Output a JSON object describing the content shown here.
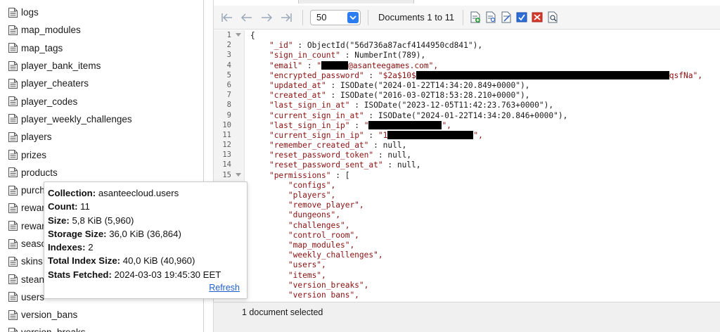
{
  "sidebar": {
    "items": [
      {
        "label": "logs"
      },
      {
        "label": "map_modules"
      },
      {
        "label": "map_tags"
      },
      {
        "label": "player_bank_items"
      },
      {
        "label": "player_cheaters"
      },
      {
        "label": "player_codes"
      },
      {
        "label": "player_weekly_challenges"
      },
      {
        "label": "players"
      },
      {
        "label": "prizes"
      },
      {
        "label": "products"
      },
      {
        "label": "purch"
      },
      {
        "label": "rewar"
      },
      {
        "label": "rewar"
      },
      {
        "label": "seaso"
      },
      {
        "label": "skins"
      },
      {
        "label": "stean"
      },
      {
        "label": "users"
      },
      {
        "label": "version_bans"
      },
      {
        "label": "version_breaks"
      }
    ],
    "icon": "collection-document-icon"
  },
  "toolbar": {
    "page_size": "50",
    "documents_range": "Documents 1 to 11",
    "nav_icons": [
      "first-page-icon",
      "previous-page-icon",
      "next-page-icon",
      "last-page-icon"
    ],
    "tool_icons": [
      "add-document-icon",
      "view-document-icon",
      "edit-document-icon",
      "select-document-icon",
      "delete-document-icon",
      "find-document-icon"
    ]
  },
  "editor": {
    "line_numbers": [
      "1",
      "2",
      "3",
      "4",
      "5",
      "6",
      "7",
      "8",
      "9",
      "10",
      "11",
      "12",
      "13",
      "14",
      "15",
      "",
      "",
      "",
      "",
      "",
      "",
      "",
      "",
      "",
      "",
      "",
      ""
    ],
    "colors": {
      "key": "#8a1010",
      "string": "#8a1010",
      "gutter": "#f3f3f3"
    }
  },
  "document": {
    "open": "{",
    "id_key": "\"_id\"",
    "id_val": "ObjectId(\"56d736a87acf4144950cd841\"),",
    "sign_in_count_key": "\"sign_in_count\"",
    "sign_in_count_val": "NumberInt(789),",
    "email_key": "\"email\"",
    "email_pre": "\"",
    "email_post": "@asanteegames.com\",",
    "encrypted_password_key": "\"encrypted_password\"",
    "encrypted_password_pre": "\"$2a$10$",
    "encrypted_password_post": "qsfNa\",",
    "updated_at_key": "\"updated_at\"",
    "updated_at_val": "ISODate(\"2024-01-22T14:34:20.849+0000\"),",
    "created_at_key": "\"created_at\"",
    "created_at_val": "ISODate(\"2016-03-02T18:53:28.210+0000\"),",
    "last_sign_in_at_key": "\"last_sign_in_at\"",
    "last_sign_in_at_val": "ISODate(\"2023-12-05T11:42:23.763+0000\"),",
    "current_sign_in_at_key": "\"current_sign_in_at\"",
    "current_sign_in_at_val": "ISODate(\"2024-01-22T14:34:20.846+0000\"),",
    "last_sign_in_ip_key": "\"last_sign_in_ip\"",
    "last_sign_in_ip_pre": "\"",
    "last_sign_in_ip_post": "\",",
    "current_sign_in_ip_key": "\"current_sign_in_ip\"",
    "current_sign_in_ip_pre": "\"1",
    "current_sign_in_ip_post": "\",",
    "remember_created_at_key": "\"remember_created_at\"",
    "remember_created_at_val": "null,",
    "reset_password_token_key": "\"reset_password_token\"",
    "reset_password_token_val": "null,",
    "reset_password_sent_at_key": "\"reset_password_sent_at\"",
    "reset_password_sent_at_val": "null,",
    "permissions_key": "\"permissions\"",
    "permissions_open": "[",
    "permissions": [
      "\"configs\",",
      "\"players\",",
      "\"remove_player\",",
      "\"dungeons\",",
      "\"challenges\",",
      "\"control_room\",",
      "\"map_modules\",",
      "\"weekly_challenges\",",
      "\"users\",",
      "\"items\",",
      "\"version_breaks\",",
      "\"version_bans\","
    ]
  },
  "status": {
    "text": "1 document selected"
  },
  "tooltip": {
    "collection_label": "Collection:",
    "collection_value": "asanteecloud.users",
    "count_label": "Count:",
    "count_value": "11",
    "size_label": "Size:",
    "size_value": "5,8 KiB  (5,960)",
    "storage_label": "Storage Size:",
    "storage_value": "36,0 KiB  (36,864)",
    "indexes_label": "Indexes:",
    "indexes_value": "2",
    "index_size_label": "Total Index Size:",
    "index_size_value": "40,0 KiB  (40,960)",
    "fetched_label": "Stats Fetched:",
    "fetched_value": "2024-03-03 19:45:30 EET",
    "refresh_label": "Refresh"
  }
}
